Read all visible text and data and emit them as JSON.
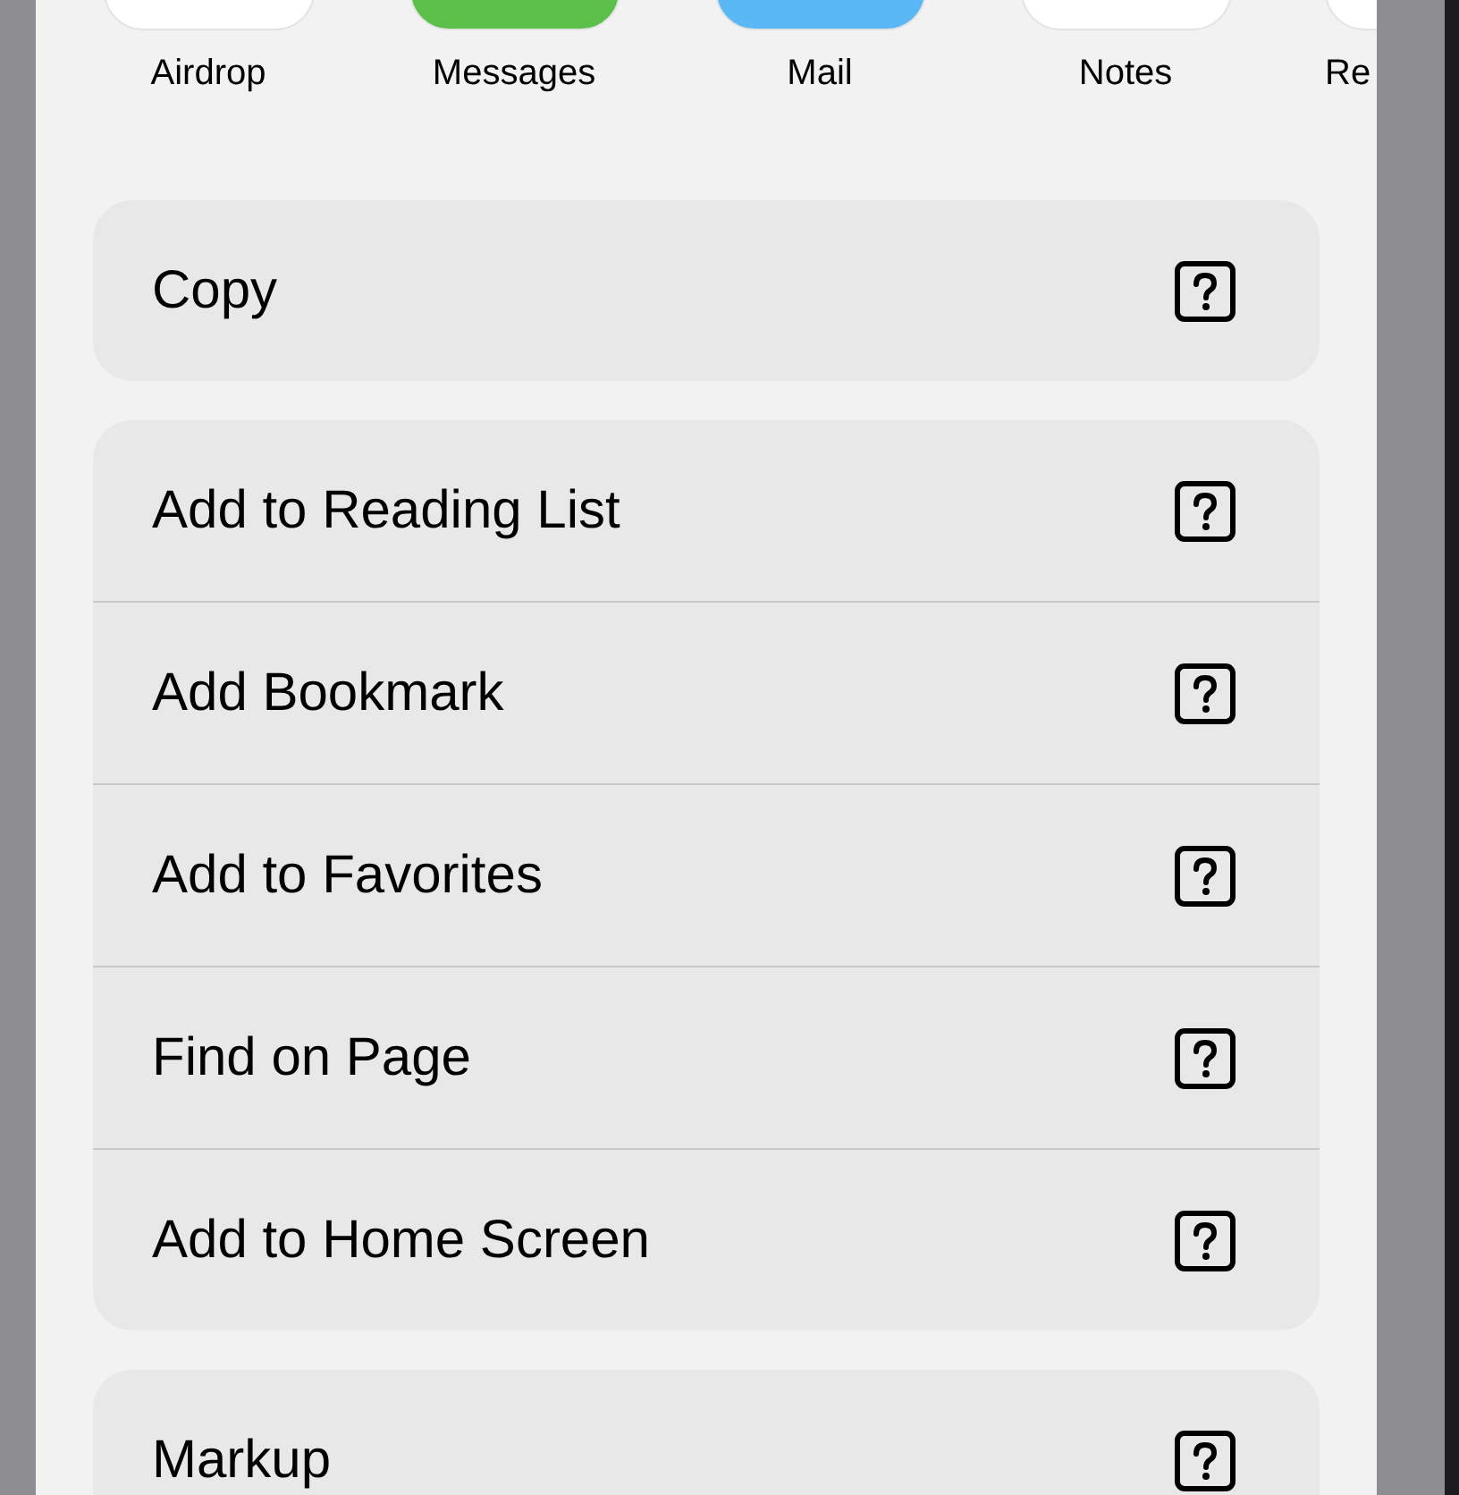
{
  "share_targets": [
    {
      "label": "Airdrop",
      "color": "#ffffff",
      "clipped": false
    },
    {
      "label": "Messages",
      "color": "#5ac04a",
      "clipped": false
    },
    {
      "label": "Mail",
      "color": "#5ab8f5",
      "clipped": false
    },
    {
      "label": "Notes",
      "color": "#ffffff",
      "clipped": false
    },
    {
      "label": "Re",
      "color": "#ffffff",
      "clipped": true
    }
  ],
  "action_groups": [
    {
      "actions": [
        {
          "label": "Copy"
        }
      ]
    },
    {
      "actions": [
        {
          "label": "Add to Reading List"
        },
        {
          "label": "Add Bookmark"
        },
        {
          "label": "Add to Favorites"
        },
        {
          "label": "Find on Page"
        },
        {
          "label": "Add to Home Screen"
        }
      ]
    },
    {
      "actions": [
        {
          "label": "Markup"
        }
      ]
    }
  ]
}
